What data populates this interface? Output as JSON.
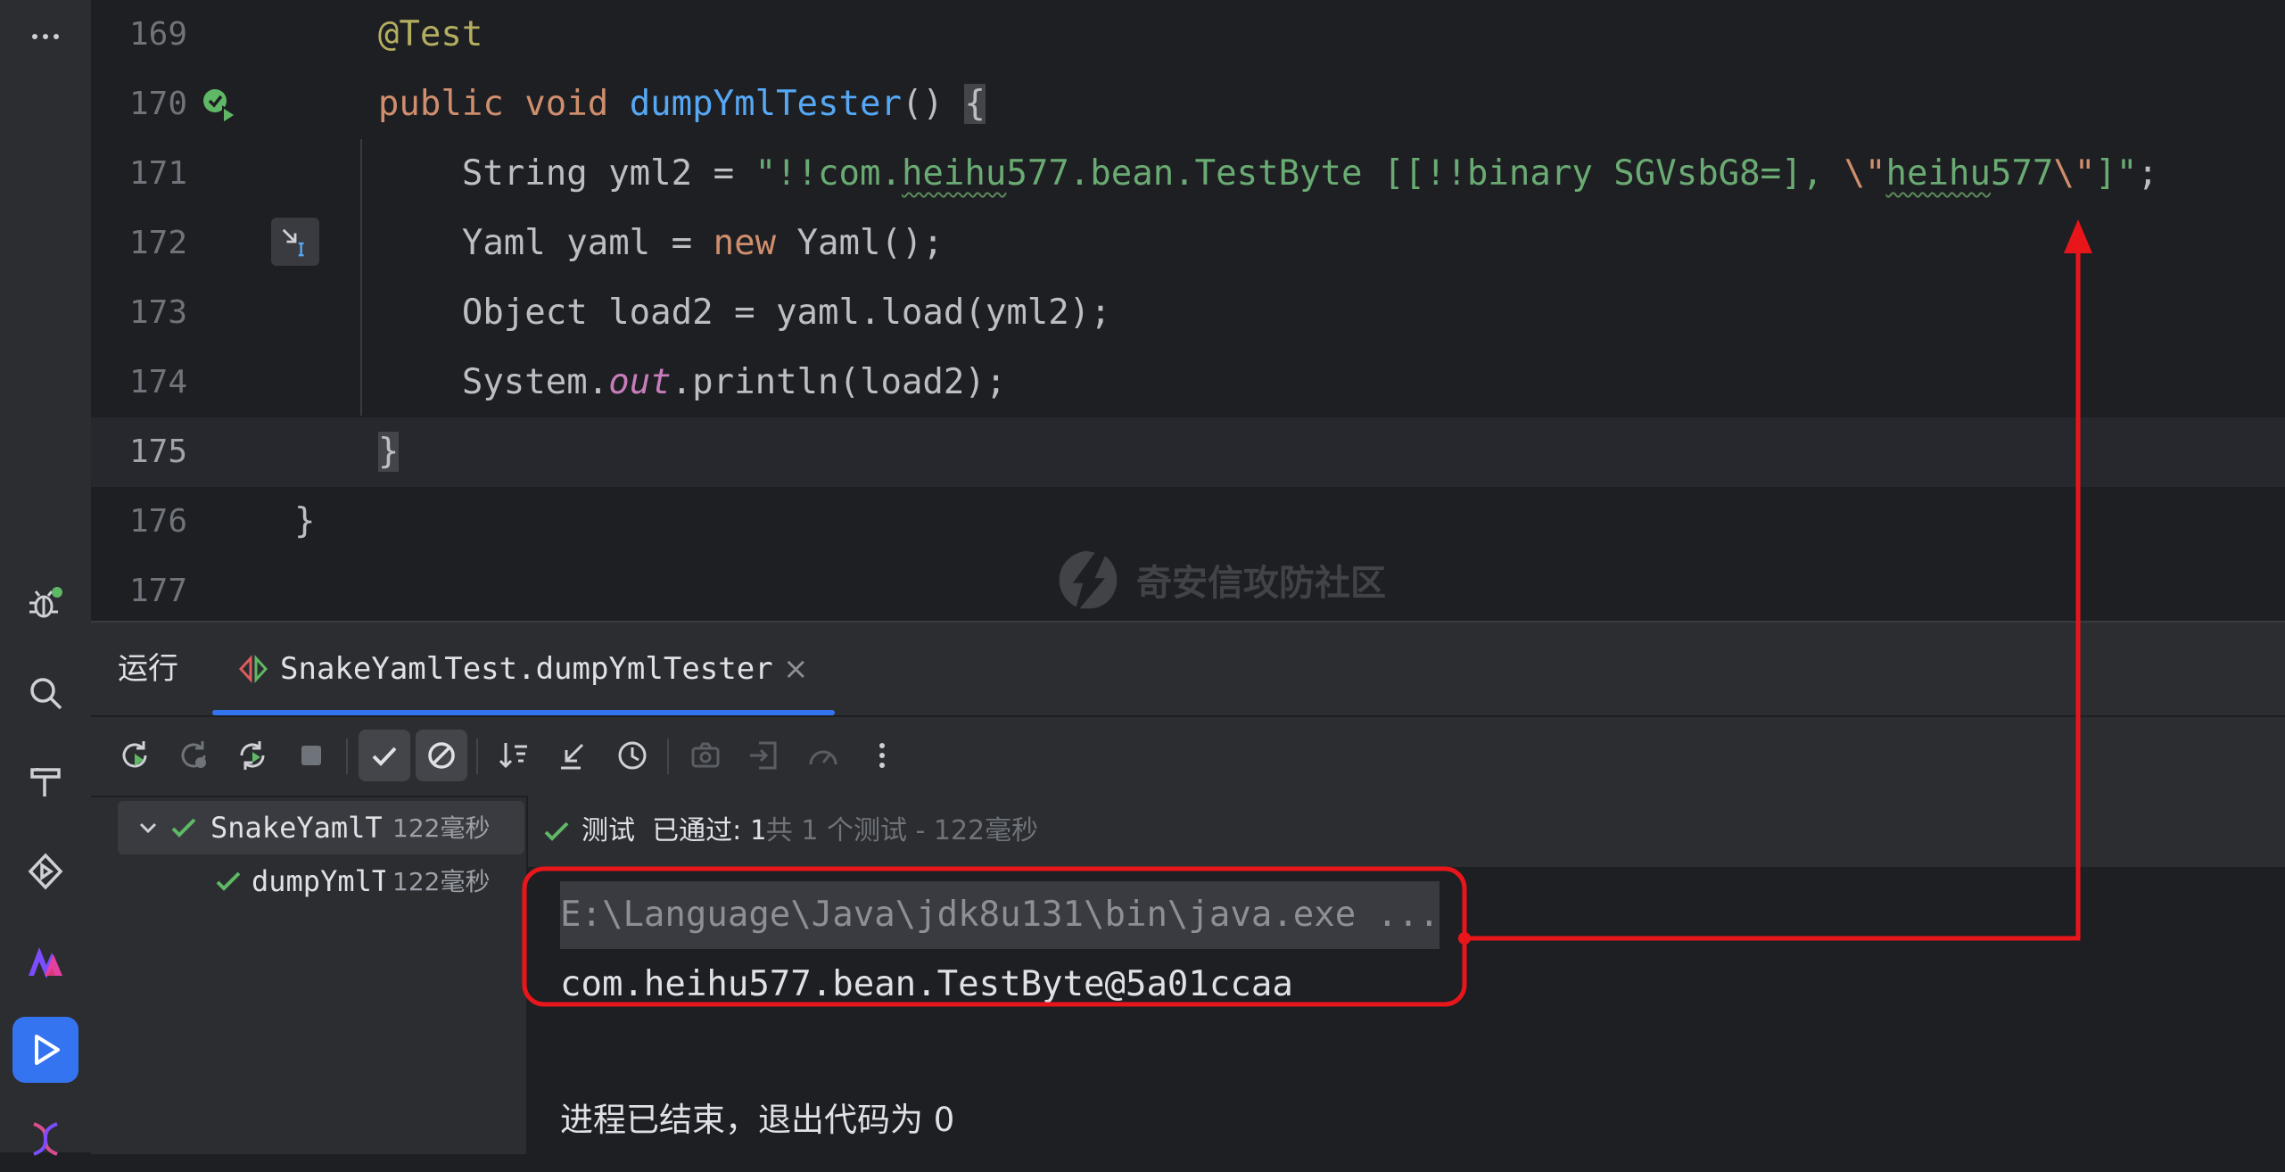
{
  "editor": {
    "lines": [
      {
        "num": "169",
        "indent": "    ",
        "tokens": [
          {
            "t": "@Test",
            "c": "tok-ann"
          }
        ]
      },
      {
        "num": "170",
        "indent": "    ",
        "tokens": [
          {
            "t": "public",
            "c": "tok-kw"
          },
          {
            "t": " "
          },
          {
            "t": "void",
            "c": "tok-kw"
          },
          {
            "t": " "
          },
          {
            "t": "dumpYmlTester",
            "c": "tok-fn"
          },
          {
            "t": "() "
          },
          {
            "t": "{",
            "c": "tok-brace-hl"
          }
        ]
      },
      {
        "num": "171",
        "indent": "        ",
        "tokens": [
          {
            "t": "String yml2 = "
          },
          {
            "t": "\"!!com.",
            "c": "tok-str"
          },
          {
            "t": "heihu",
            "c": "tok-str typo"
          },
          {
            "t": "577.bean.TestByte [[!!binary SGVsbG8=], ",
            "c": "tok-str"
          },
          {
            "t": "\\\"",
            "c": "tok-kw"
          },
          {
            "t": "heihu",
            "c": "tok-str typo"
          },
          {
            "t": "577",
            "c": "tok-str"
          },
          {
            "t": "\\\"",
            "c": "tok-kw"
          },
          {
            "t": "]\"",
            "c": "tok-str"
          },
          {
            "t": ";"
          }
        ]
      },
      {
        "num": "172",
        "indent": "        ",
        "tokens": [
          {
            "t": "Yaml yaml = "
          },
          {
            "t": "new",
            "c": "tok-kw"
          },
          {
            "t": " Yaml();"
          }
        ]
      },
      {
        "num": "173",
        "indent": "        ",
        "tokens": [
          {
            "t": "Object load2 = yaml.load(yml2);"
          }
        ]
      },
      {
        "num": "174",
        "indent": "        ",
        "tokens": [
          {
            "t": "System."
          },
          {
            "t": "out",
            "c": "tok-static"
          },
          {
            "t": ".println(load2);"
          }
        ]
      },
      {
        "num": "175",
        "indent": "    ",
        "current": true,
        "tokens": [
          {
            "t": "}",
            "c": "tok-brace-hl"
          }
        ]
      },
      {
        "num": "176",
        "indent": "",
        "tokens": [
          {
            "t": "}"
          }
        ]
      },
      {
        "num": "177",
        "indent": "",
        "tokens": []
      }
    ]
  },
  "watermark": {
    "text": "奇安信攻防社区"
  },
  "run_panel": {
    "title": "运行",
    "tab_label": "SnakeYamlTest.dumpYmlTester",
    "tab_close": "×",
    "tree": {
      "root": {
        "name": "SnakeYamlT",
        "time": "122毫秒"
      },
      "child": {
        "name": "dumpYmlT",
        "time": "122毫秒"
      }
    },
    "status": {
      "test_label": "测试",
      "passed_label": "已通过:",
      "passed_count": "1",
      "total_text": "共 1 个测试 - 122毫秒"
    },
    "console": {
      "command": "E:\\Language\\Java\\jdk8u131\\bin\\java.exe ...",
      "output": "com.heihu577.bean.TestByte@5a01ccaa",
      "exit": "进程已结束，退出代码为 0"
    }
  },
  "colors": {
    "accent": "#3574f0",
    "success": "#5fb865",
    "annotation": "#e8161b"
  }
}
